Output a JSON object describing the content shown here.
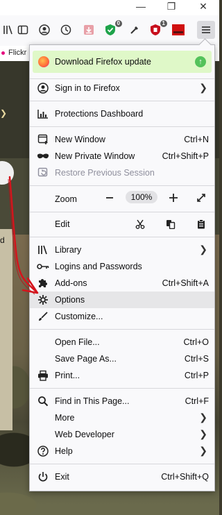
{
  "window": {
    "minimize": "—",
    "restore": "❐",
    "close": "✕"
  },
  "toolbar": {
    "badge_shield": "0",
    "badge_ublock": "1"
  },
  "bookmarks": {
    "first_label": "Flickr"
  },
  "page": {
    "left_label": "d"
  },
  "banner": {
    "label": "Download Firefox update"
  },
  "menu": {
    "sign_in": "Sign in to Firefox",
    "protections": "Protections Dashboard",
    "new_window": "New Window",
    "new_window_sc": "Ctrl+N",
    "new_private": "New Private Window",
    "new_private_sc": "Ctrl+Shift+P",
    "restore": "Restore Previous Session",
    "zoom": "Zoom",
    "zoom_value": "100%",
    "edit": "Edit",
    "library": "Library",
    "logins": "Logins and Passwords",
    "addons": "Add-ons",
    "addons_sc": "Ctrl+Shift+A",
    "options": "Options",
    "customize": "Customize...",
    "open_file": "Open File...",
    "open_file_sc": "Ctrl+O",
    "save_page": "Save Page As...",
    "save_page_sc": "Ctrl+S",
    "print": "Print...",
    "print_sc": "Ctrl+P",
    "find": "Find in This Page...",
    "find_sc": "Ctrl+F",
    "more": "More",
    "web_dev": "Web Developer",
    "help": "Help",
    "exit": "Exit",
    "exit_sc": "Ctrl+Shift+Q"
  },
  "colors": {
    "banner_bg": "#dff8c8",
    "annotation_arrow": "#d4141c",
    "highlight_row": "#e6e6e8"
  }
}
